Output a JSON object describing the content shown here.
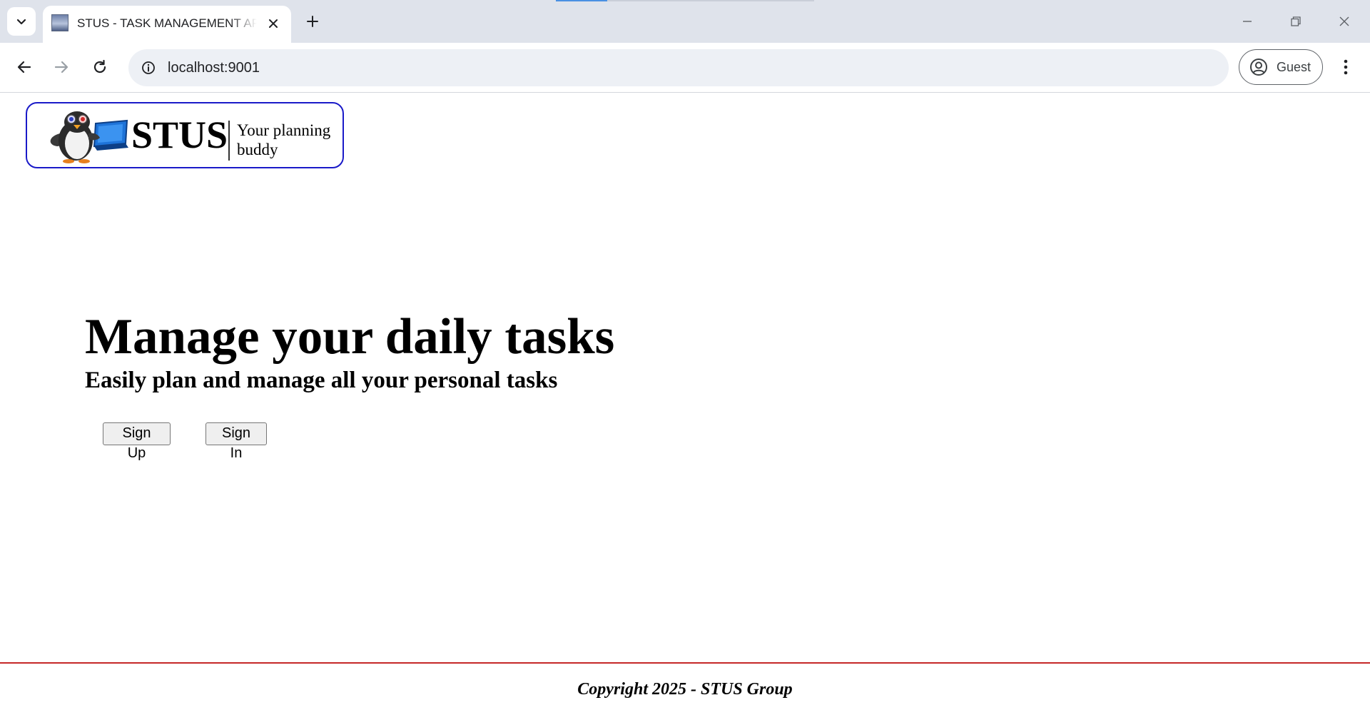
{
  "browser": {
    "tab": {
      "title": "STUS - TASK MANAGEMENT APP"
    },
    "address_bar": {
      "url": "localhost:9001"
    },
    "profile": {
      "label": "Guest"
    },
    "icons": {
      "tab_search": "chevron-down-icon",
      "tab_favicon": "site-favicon-icon",
      "tab_close": "close-icon",
      "new_tab": "plus-icon",
      "minimize": "minimize-icon",
      "restore": "restore-icon",
      "close_window": "close-icon",
      "back": "arrow-left-icon",
      "forward": "arrow-right-icon",
      "reload": "reload-icon",
      "site_info": "info-icon",
      "profile": "person-circle-icon",
      "menu": "kebab-menu-icon"
    }
  },
  "header": {
    "logo": {
      "name": "STUS",
      "tagline": "Your planning buddy",
      "border_color": "#1a1ac8"
    }
  },
  "hero": {
    "title": "Manage your daily tasks",
    "subtitle": "Easily plan and manage all your personal tasks",
    "signup_label": "Sign Up",
    "signin_label": "Sign In"
  },
  "footer": {
    "copyright": "Copyright 2025 - STUS Group",
    "rule_color": "#c62828"
  }
}
